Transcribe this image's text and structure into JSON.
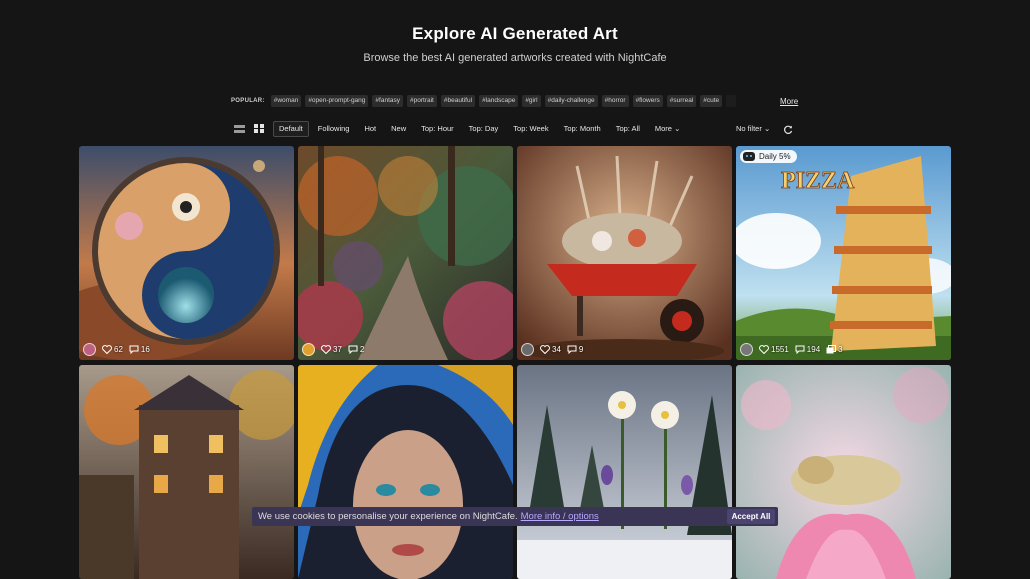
{
  "hero": {
    "title": "Explore AI Generated Art",
    "subtitle": "Browse the best AI generated artworks created with NightCafe"
  },
  "popular": {
    "label": "POPULAR:",
    "tags": [
      "#woman",
      "#open-prompt-gang",
      "#fantasy",
      "#portrait",
      "#beautiful",
      "#landscape",
      "#girl",
      "#daily-challenge",
      "#horror",
      "#flowers",
      "#surreal",
      "#cute"
    ],
    "more": "More"
  },
  "filters": {
    "view_icons": [
      "list-view-icon",
      "grid-view-icon"
    ],
    "tabs": [
      "Default",
      "Following",
      "Hot",
      "New",
      "Top: Hour",
      "Top: Day",
      "Top: Week",
      "Top: Month",
      "Top: All",
      "More"
    ],
    "active_tab": "Default",
    "no_filter": "No filter"
  },
  "cards": [
    {
      "likes": "62",
      "comments": "16",
      "art": "yin-yang"
    },
    {
      "likes": "37",
      "comments": "2",
      "art": "forest-path"
    },
    {
      "likes": "34",
      "comments": "9",
      "art": "wheelbarrow-flowers"
    },
    {
      "likes": "1551",
      "comments": "194",
      "images": "3",
      "badge": "Daily 5%",
      "art": "pizza-tower"
    },
    {
      "art": "autumn-town"
    },
    {
      "art": "hooded-woman"
    },
    {
      "art": "winter-flowers"
    },
    {
      "art": "lotus-dragon"
    }
  ],
  "cookie": {
    "message": "We use cookies to personalise your experience on NightCafe.",
    "link": "More info / options",
    "accept": "Accept All"
  },
  "colors": {
    "background": "#151515",
    "cookie_bar": "#3a3455",
    "accent_link": "#b8a8ff"
  }
}
